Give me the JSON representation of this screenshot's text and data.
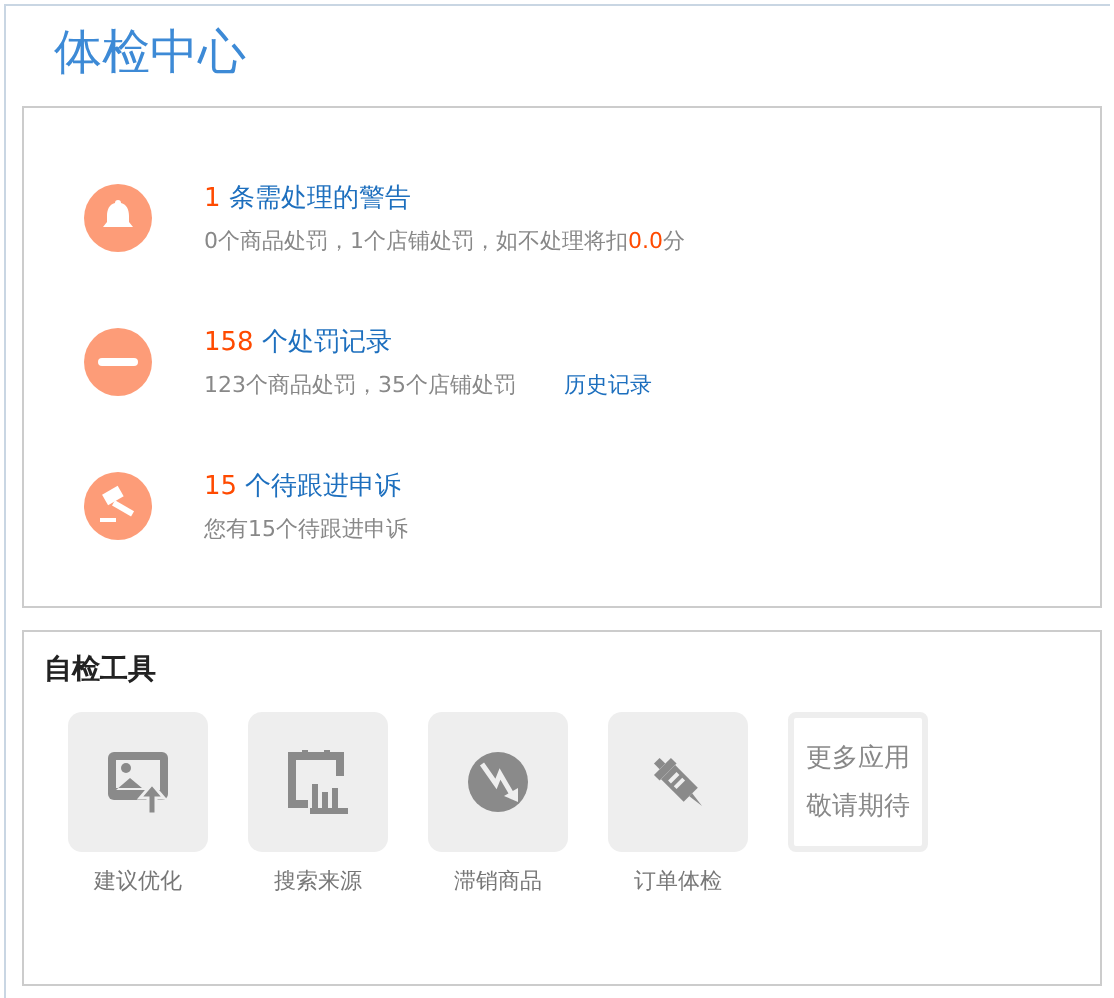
{
  "page": {
    "title": "体检中心"
  },
  "records": [
    {
      "kind": "bell",
      "count": "1",
      "title": "条需处理的警告",
      "detail": "0个商品处罚，1个店铺处罚，如不处理将扣",
      "score": "0.0",
      "score_unit": "分"
    },
    {
      "kind": "minus",
      "count": "158",
      "title": "个处罚记录",
      "detail": "123个商品处罚，35个店铺处罚",
      "link": "历史记录"
    },
    {
      "kind": "gavel",
      "count": "15",
      "title": "个待跟进申诉",
      "detail": "您有15个待跟进申诉"
    }
  ],
  "tools": {
    "title": "自检工具",
    "items": [
      {
        "kind": "image-upload",
        "label": "建议优化"
      },
      {
        "kind": "chart",
        "label": "搜索来源"
      },
      {
        "kind": "down-trend",
        "label": "滞销商品"
      },
      {
        "kind": "syringe",
        "label": "订单体检"
      }
    ],
    "more": [
      "更多应用",
      "敬请期待"
    ]
  }
}
